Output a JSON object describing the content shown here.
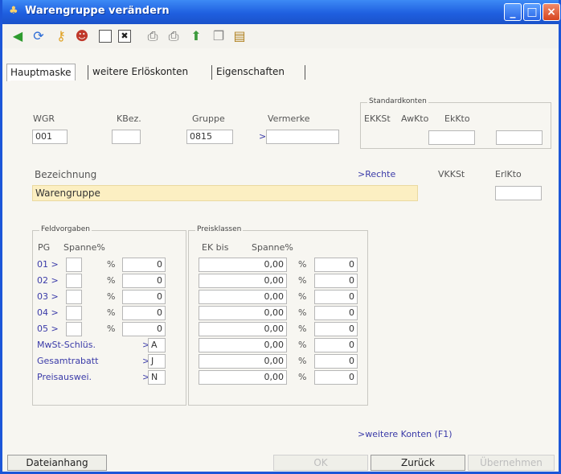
{
  "window": {
    "title": "Warengruppe verändern",
    "minimize": "_",
    "maximize": "□",
    "close": "×"
  },
  "toolbar": {
    "icons": [
      "back-arrow-icon",
      "refresh-icon",
      "key-icon",
      "person-icon",
      "new-doc-icon",
      "delete-doc-icon",
      "print-icon",
      "print-preview-icon",
      "export-icon",
      "copy-icon",
      "paste-icon"
    ]
  },
  "tabs": [
    "Hauptmaske",
    "weitere Erlöskonten",
    "Eigenschaften"
  ],
  "header": {
    "wgr_label": "WGR",
    "kbez_label": "KBez.",
    "gruppe_label": "Gruppe",
    "vermerke_label": "Vermerke",
    "wgr_value": "001",
    "kbez_value": "",
    "gruppe_value": "0815",
    "vermerke_arrow": ">",
    "vermerke_value": ""
  },
  "standardkonten": {
    "title": "Standardkonten",
    "ekkst": "EKKSt",
    "awkto": "AwKto",
    "ekkto": "EkKto"
  },
  "bezeichnung": {
    "label": "Bezeichnung",
    "value": "Warengruppe",
    "rechte": ">Rechte",
    "vkkst": "VKKSt",
    "erlkto": "ErlKto"
  },
  "feldvorgaben": {
    "title": "Feldvorgaben",
    "pg_label": "PG",
    "spanne_label": "Spanne%",
    "rows": [
      {
        "pg": "01 >",
        "pct": "%",
        "value": "0"
      },
      {
        "pg": "02 >",
        "pct": "%",
        "value": "0"
      },
      {
        "pg": "03 >",
        "pct": "%",
        "value": "0"
      },
      {
        "pg": "04 >",
        "pct": "%",
        "value": "0"
      },
      {
        "pg": "05 >",
        "pct": "%",
        "value": "0"
      }
    ],
    "extra": [
      {
        "label": "MwSt-Schlüs.",
        "arrow": ">",
        "value": "A"
      },
      {
        "label": "Gesamtrabatt",
        "arrow": ">",
        "value": "J"
      },
      {
        "label": "Preisauswei.",
        "arrow": ">",
        "value": "N"
      }
    ]
  },
  "preisklassen": {
    "title": "Preisklassen",
    "ekbis_label": "EK bis",
    "spanne_label": "Spanne%",
    "rows": [
      {
        "ek": "0,00",
        "pct": "%",
        "value": "0"
      },
      {
        "ek": "0,00",
        "pct": "%",
        "value": "0"
      },
      {
        "ek": "0,00",
        "pct": "%",
        "value": "0"
      },
      {
        "ek": "0,00",
        "pct": "%",
        "value": "0"
      },
      {
        "ek": "0,00",
        "pct": "%",
        "value": "0"
      },
      {
        "ek": "0,00",
        "pct": "%",
        "value": "0"
      },
      {
        "ek": "0,00",
        "pct": "%",
        "value": "0"
      },
      {
        "ek": "0,00",
        "pct": "%",
        "value": "0"
      }
    ]
  },
  "footer": {
    "weitere_konten": ">weitere Konten (F1)",
    "dateianhang": "Dateianhang",
    "ok": "OK",
    "zurueck": "Zurück",
    "uebernehmen": "Übernehmen"
  }
}
